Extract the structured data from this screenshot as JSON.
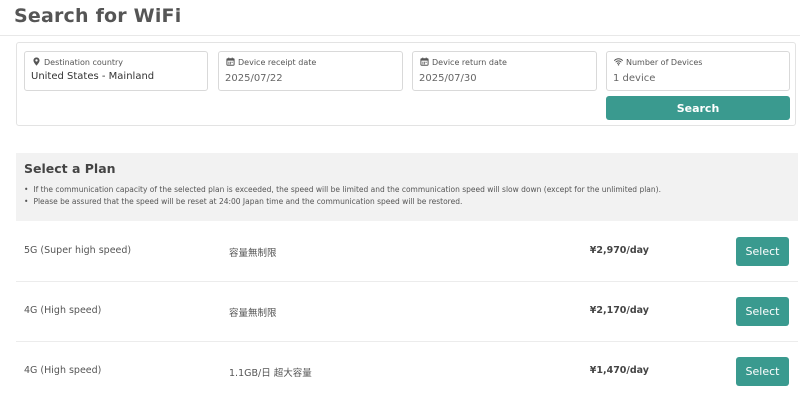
{
  "page": {
    "title": "Search for WiFi"
  },
  "search": {
    "destination": {
      "label": "Destination country",
      "value": "United States - Mainland",
      "icon": "location-pin-icon"
    },
    "receipt_date": {
      "label": "Device receipt date",
      "value": "2025/07/22",
      "icon": "calendar-icon"
    },
    "return_date": {
      "label": "Device return date",
      "value": "2025/07/30",
      "icon": "calendar-icon"
    },
    "devices": {
      "label": "Number of Devices",
      "value": "1 device",
      "icon": "wifi-icon"
    },
    "button_label": "Search"
  },
  "plans": {
    "title": "Select a Plan",
    "notes": [
      "If the communication capacity of the selected plan is exceeded, the speed will be limited and the communication speed will slow down (except for the unlimited plan).",
      "Please be assured that the speed will be reset at 24:00 Japan time and the communication speed will be restored."
    ],
    "bullet": "•",
    "items": [
      {
        "name": "5G (Super high speed)",
        "capacity": "容量無制限",
        "price": "¥2,970/day",
        "button": "Select"
      },
      {
        "name": "4G (High speed)",
        "capacity": "容量無制限",
        "price": "¥2,170/day",
        "button": "Select"
      },
      {
        "name": "4G (High speed)",
        "capacity": "1.1GB/日 超大容量",
        "price": "¥1,470/day",
        "button": "Select"
      }
    ]
  },
  "colors": {
    "accent": "#3a9a8f",
    "panel": "#f2f2f2",
    "border": "#d9d9d9"
  }
}
